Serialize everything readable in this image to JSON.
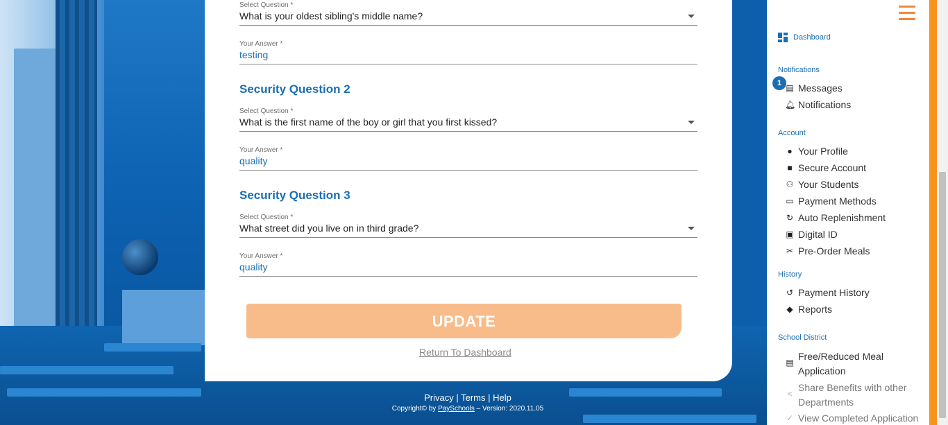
{
  "form": {
    "q1": {
      "select_label": "Select Question *",
      "question": "What is your oldest sibling's middle name?",
      "answer_label": "Your Answer *",
      "answer": "testing"
    },
    "q2": {
      "title": "Security Question 2",
      "select_label": "Select Question *",
      "question": "What is the first name of the boy or girl that you first kissed?",
      "answer_label": "Your Answer *",
      "answer": "quality"
    },
    "q3": {
      "title": "Security Question 3",
      "select_label": "Select Question *",
      "question": "What street did you live on in third grade?",
      "answer_label": "Your Answer *",
      "answer": "quality"
    },
    "update_label": "UPDATE",
    "return_label": "Return To Dashboard"
  },
  "footer": {
    "privacy": "Privacy",
    "terms": "Terms",
    "help": "Help",
    "copyright_prefix": "Copyright© by",
    "brand": "PaySchools",
    "version": "– Version: 2020.11.05"
  },
  "sidebar": {
    "dashboard": "Dashboard",
    "notifications_head": "Notifications",
    "messages_badge": "1",
    "messages": "Messages",
    "notifications": "Notifications",
    "account_head": "Account",
    "your_profile": "Your Profile",
    "secure_account": "Secure Account",
    "your_students": "Your Students",
    "payment_methods": "Payment Methods",
    "auto_replenishment": "Auto Replenishment",
    "digital_id": "Digital ID",
    "pre_order_meals": "Pre-Order Meals",
    "history_head": "History",
    "payment_history": "Payment History",
    "reports": "Reports",
    "district_head": "School District",
    "free_reduced_1": "Free/Reduced Meal",
    "free_reduced_2": "Application",
    "share_benefits_1": "Share Benefits with other",
    "share_benefits_2": "Departments",
    "view_completed": "View Completed Application"
  },
  "colors": {
    "accent": "#1a6fb3",
    "update_button": "#f8bb8a",
    "menu_orange": "#f3873a"
  }
}
